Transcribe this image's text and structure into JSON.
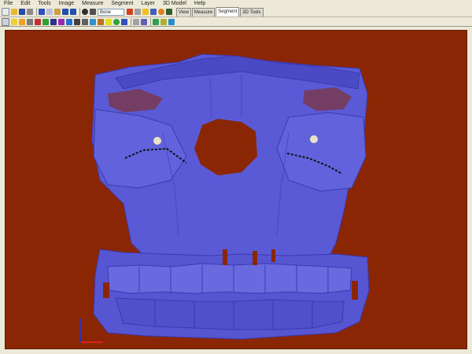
{
  "menu": {
    "items": [
      "File",
      "Edit",
      "Tools",
      "Image",
      "Measure",
      "Segment",
      "Layer",
      "3D Model",
      "Help"
    ]
  },
  "toolbar": {
    "view_combo_value": "Bone",
    "icons_row1": [
      "new-file-icon",
      "open-folder-icon",
      "save-icon",
      "print-icon",
      "pointer-icon",
      "copy-icon",
      "paste-icon",
      "undo-icon",
      "redo-icon",
      "rotate-icon",
      "pan-icon",
      "zoom-in-icon",
      "zoom-out-icon",
      "window-level-icon",
      "info-icon",
      "measure-icon",
      "image-icon"
    ],
    "icons_row2": [
      "axial-icon",
      "coronal-icon",
      "sagittal-icon",
      "grid-icon",
      "crosshair-icon",
      "ruler-icon",
      "angle-icon",
      "pen-icon",
      "line-icon",
      "circle-icon",
      "rectangle-icon",
      "color-icon",
      "lock-icon",
      "layer-icon",
      "sphere-icon",
      "cube-icon",
      "screenshot-icon",
      "settings-icon"
    ]
  },
  "tabs": [
    {
      "label": "View"
    },
    {
      "label": "Measure"
    },
    {
      "label": "Segment"
    },
    {
      "label": "3D Tools"
    }
  ],
  "active_tab_index": 2,
  "viewport": {
    "background_color": "#8b2605",
    "model_color": "#5a5ad6",
    "model_name": "skull-3d-render",
    "axis_colors": {
      "x": "#e02020",
      "y": "#2030e0"
    }
  }
}
